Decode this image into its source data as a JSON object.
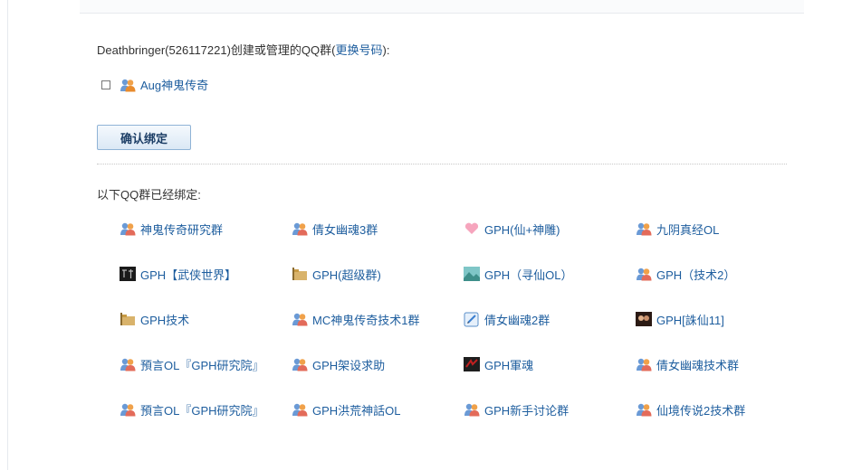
{
  "owner": {
    "prefix": "Deathbringer(526117221)创建或管理的QQ群(",
    "change_link": "更换号码",
    "suffix": "):"
  },
  "managed_group": {
    "name": "Aug神鬼传奇",
    "icon": "qq-group-icon",
    "checked": false
  },
  "confirm_button": "确认绑定",
  "bound_title": "以下QQ群已经绑定:",
  "bound_groups": [
    {
      "name": "神鬼传奇研究群",
      "icon": "qq-group-icon"
    },
    {
      "name": "倩女幽魂3群",
      "icon": "qq-group-icon"
    },
    {
      "name": "GPH(仙+神雕)",
      "icon": "heart-group-icon"
    },
    {
      "name": "九阴真经OL",
      "icon": "qq-group-icon"
    },
    {
      "name": "GPH【武侠世界】",
      "icon": "martial-world-icon"
    },
    {
      "name": "GPH(超级群)",
      "icon": "folder-group-icon"
    },
    {
      "name": "GPH（寻仙OL）",
      "icon": "landscape-group-icon"
    },
    {
      "name": "GPH（技术2）",
      "icon": "qq-group-icon"
    },
    {
      "name": "GPH技术",
      "icon": "folder-group-icon"
    },
    {
      "name": "MC神鬼传奇技术1群",
      "icon": "qq-group-icon"
    },
    {
      "name": "倩女幽魂2群",
      "icon": "edit-group-icon"
    },
    {
      "name": "GPH[誅仙11]",
      "icon": "photo-group-icon"
    },
    {
      "name": "預言OL『GPH研究院』",
      "icon": "qq-group-icon"
    },
    {
      "name": "GPH架设求助",
      "icon": "qq-group-icon"
    },
    {
      "name": "GPH軍魂",
      "icon": "dark-red-group-icon"
    },
    {
      "name": "倩女幽魂技术群",
      "icon": "qq-group-icon"
    },
    {
      "name": "預言OL『GPH研究院』",
      "icon": "qq-group-icon"
    },
    {
      "name": "GPH洪荒神話OL",
      "icon": "qq-group-icon"
    },
    {
      "name": "GPH新手讨论群",
      "icon": "qq-group-icon"
    },
    {
      "name": "仙境传说2技术群",
      "icon": "qq-group-icon"
    }
  ]
}
